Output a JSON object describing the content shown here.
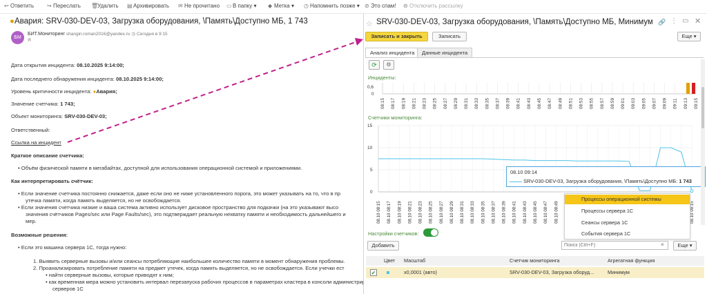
{
  "toolbar": {
    "items": [
      "Ответить",
      "Переслать",
      "Удалить",
      "Архивировать",
      "Не прочитано",
      "В папку ▾",
      "Метка ▾",
      "Напомнить позже ▾",
      "Это спам!",
      "Отключить рассылку"
    ]
  },
  "mail": {
    "subject": "Авария: SRV-030-DEV-03, Загрузка оборудования, \\Память\\Доступно МБ, 1 743",
    "avatar": "БМ",
    "sender": "БИТ.Мониторинг",
    "sender_email": "shangin.roman2016@yandex.ru",
    "date": "Сегодня в 9:15",
    "to": "Я",
    "lines": [
      {
        "label": "Дата открытия инцидента:",
        "value": "08.10.2025 9:14:00;"
      },
      {
        "label": "Дата последнего обнаружения инцидента:",
        "value": "08.10.2025 9:14:00;"
      },
      {
        "label": "Уровень критичности инцидента:",
        "value": "Авария;"
      },
      {
        "label": "Значение счетчика:",
        "value": "1 743;"
      },
      {
        "label": "Объект мониторинга:",
        "value": "SRV-030-DEV-03;"
      },
      {
        "label": "Ответственный:",
        "value": ""
      }
    ],
    "link": "Ссылка на инцидент",
    "h_short": "Краткое описание счетчика:",
    "short_desc": "Объём физической памяти в мегабайтах, доступной для использования операционной системой и приложениями.",
    "h_interp": "Как интерпретировать счётчик:",
    "interp": [
      "Если значение счетчика постоянно снижается, даже если оно не ниже установленного порога, это может указывать на то, что в пр",
      "утечка памяти, когда память выделяется, но не освобождается.",
      "Если значения счетчика низкие и ваша система активно использует дисковое пространство для подкачки (на это указывают высо",
      "значения счётчиков Pages/sec или Page Faults/sec), это подтверждает реальную нехватку памяти и необходимость дальнейшего и",
      "мер."
    ],
    "h_solutions": "Возможные решения:",
    "sol1": "Если это машина сервера 1С, тогда нужно:",
    "steps": [
      "1. Выявить серверные вызовы и/или сеансы потребляющие наибольшее количество памяти в момент обнаружения проблемы.",
      "2. Проанализировать потребление памяти на предмет утечек, когда память выделяется, но не освобождается. Если учечки ест",
      "найти серверные вызовы, которые приводят к ним;",
      "как временная мера можно установить интервал перезапуска рабочих процессов в параметрах кластера в консоли администрирования",
      "серверов 1С"
    ]
  },
  "window": {
    "title": "SRV-030-DEV-03, Загрузка оборудования, \\Память\\Доступно МБ, Минимум ...",
    "btn_save_close": "Записать и закрыть",
    "btn_save": "Записать",
    "btn_more": "Еще ▾",
    "tabs": [
      "Анализ инцидента",
      "Данные инцидента"
    ],
    "incidents_label": "Инциденты:",
    "counters_label": "Счетчики мониторинга:",
    "settings_label": "Настройки счетчиков:",
    "add_btn": "Добавить",
    "search_placeholder": "Поиск (Ctrl+F)",
    "more2": "Еще ▾",
    "tooltip_time": "08.10 09:14",
    "tooltip_series": "SRV-030-DEV-03, Загрузка оборудования, \\Память\\Доступно МБ:",
    "tooltip_value": "1 743",
    "menu": [
      "Процессы операционной системы",
      "Процессы сервера 1С",
      "Сеансы сервера 1С",
      "События сервера 1С"
    ],
    "table_headers": [
      "Цвет",
      "Масштаб",
      "Счетчик мониторинга",
      "Агрегатная функция"
    ],
    "row": {
      "scale": "x0,0001 (авто)",
      "counter": "SRV-030-DEV-03, Загрузка оборуд...",
      "func": "Минимум"
    },
    "accent": "#f5c518",
    "series_color": "#4fc3e8"
  },
  "chart_data": [
    {
      "type": "bar",
      "title": "Инциденты:",
      "ylim": [
        0,
        1
      ],
      "yticks": [
        "0,6",
        "0"
      ],
      "x": [
        "08:15",
        "08:17",
        "08:19",
        "08:21",
        "08:23",
        "08:25",
        "08:27",
        "08:29",
        "08:31",
        "08:33",
        "08:35",
        "08:37",
        "08:39",
        "08:41",
        "08:43",
        "08:45",
        "08:47",
        "08:49",
        "08:51",
        "08:53",
        "08:55",
        "08:57",
        "08:59",
        "09:01",
        "09:03",
        "09:05",
        "09:07",
        "09:09",
        "09:11",
        "09:13",
        "09:15"
      ],
      "bars": [
        {
          "x": "09:14",
          "value": 1,
          "color": "#e0a000"
        },
        {
          "x": "09:15",
          "value": 1,
          "color": "#d42020"
        }
      ]
    },
    {
      "type": "line",
      "title": "Счетчики мониторинга:",
      "ylim": [
        0,
        15
      ],
      "yticks": [
        "15",
        "10",
        "5",
        "0"
      ],
      "x_labels": [
        "08.10 08:15",
        "08.10 08:17",
        "08.10 08:19",
        "08.10 08:21",
        "08.10 08:23",
        "08.10 08:25",
        "08.10 08:27",
        "08.10 08:29",
        "08.10 08:31",
        "08.10 08:33",
        "08.10 08:35",
        "08.10 08:37",
        "08.10 08:39",
        "08.10 08:41",
        "08.10 08:43",
        "08.10 08:45",
        "08.10 08:47",
        "08.10 08:49",
        "08.10 08:51",
        "08.10 08:53",
        "08.10 08:55",
        "08.10 08:57",
        "08.10 08:59",
        "08.10 09:01",
        "08.10 09:03",
        "08.10 09:05",
        "08.10 09:07",
        "08.10 09:09",
        "08.10 09:11",
        "08.10 09:13",
        "08.10 09:15"
      ],
      "series": [
        {
          "values": [
            7.5,
            7.5,
            7.5,
            7.5,
            7.5,
            7.5,
            7.5,
            7.5,
            7.5,
            7.5,
            7.5,
            7.4,
            7.3,
            7.2,
            7.2,
            7.1,
            7.1,
            7.1,
            7.1,
            7.0,
            7.0,
            7.0,
            7.0,
            7.0,
            6.9,
            0.3,
            0.3,
            10,
            10,
            9,
            0.2
          ]
        }
      ]
    }
  ]
}
